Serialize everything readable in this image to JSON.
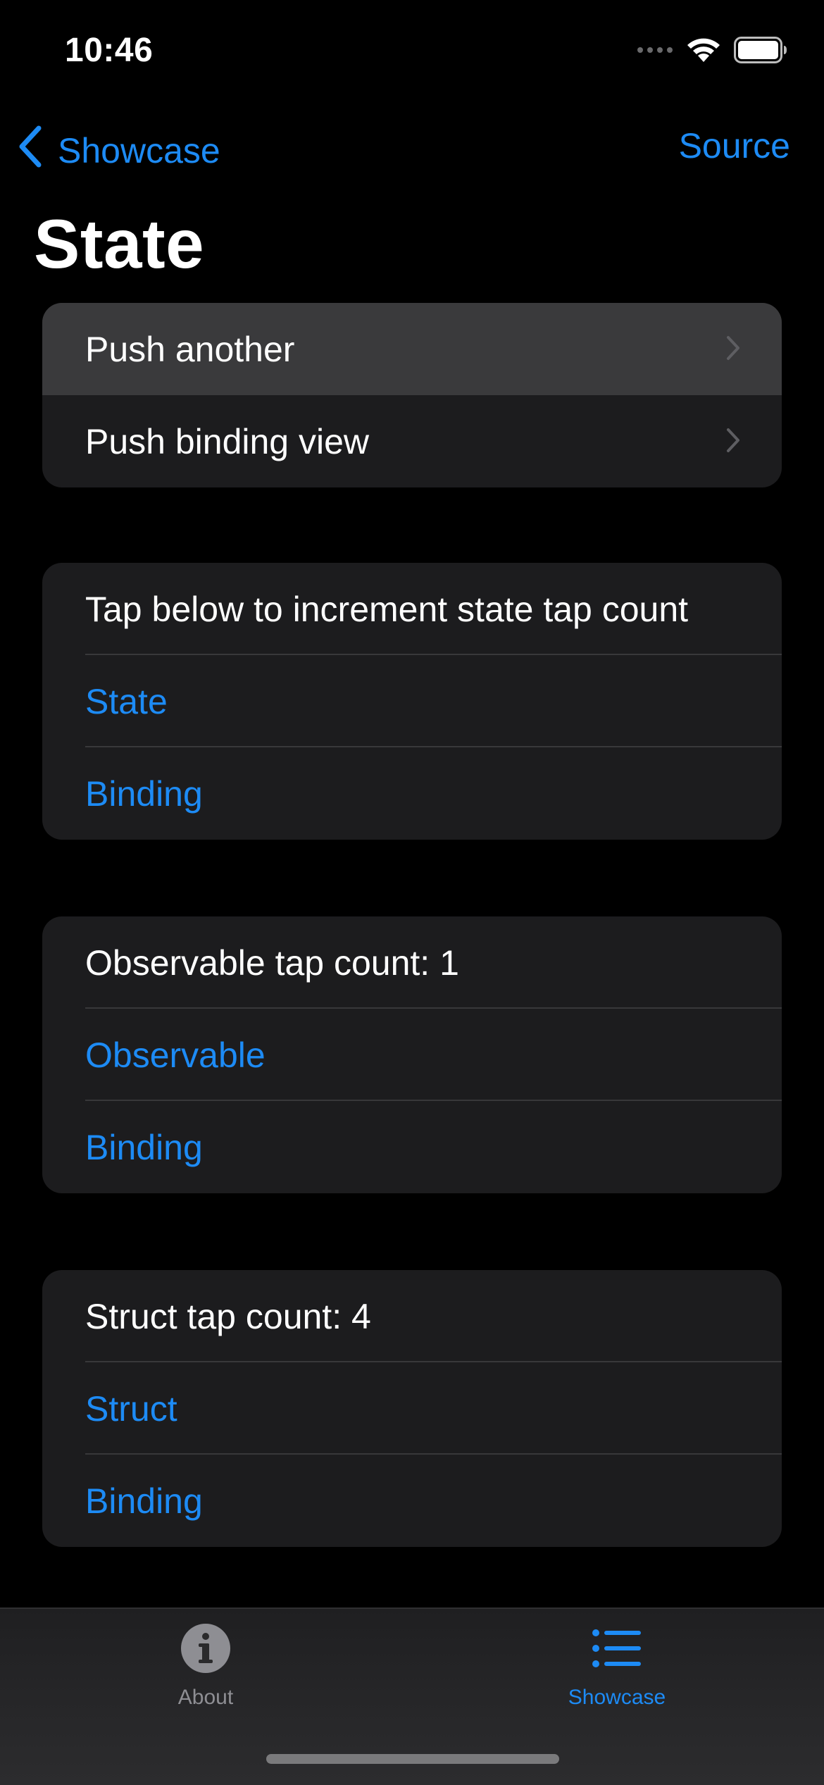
{
  "status": {
    "time": "10:46"
  },
  "nav": {
    "back_label": "Showcase",
    "right_label": "Source"
  },
  "title": "State",
  "groups": [
    {
      "rows": [
        {
          "label": "Push another"
        },
        {
          "label": "Push binding view"
        }
      ]
    },
    {
      "rows": [
        {
          "label": "Tap below to increment state tap count"
        },
        {
          "label": "State"
        },
        {
          "label": "Binding"
        }
      ]
    },
    {
      "rows": [
        {
          "label": "Observable tap count: 1"
        },
        {
          "label": "Observable"
        },
        {
          "label": "Binding"
        }
      ]
    },
    {
      "rows": [
        {
          "label": "Struct tap count: 4"
        },
        {
          "label": "Struct"
        },
        {
          "label": "Binding"
        }
      ]
    }
  ],
  "tabs": [
    {
      "label": "About",
      "icon": "info-icon",
      "selected": false
    },
    {
      "label": "Showcase",
      "icon": "list-icon",
      "selected": true
    }
  ],
  "colors": {
    "accent": "#1d8bf5",
    "inactive": "#8e8e93",
    "background": "#000000",
    "cell": "#1c1c1e"
  }
}
